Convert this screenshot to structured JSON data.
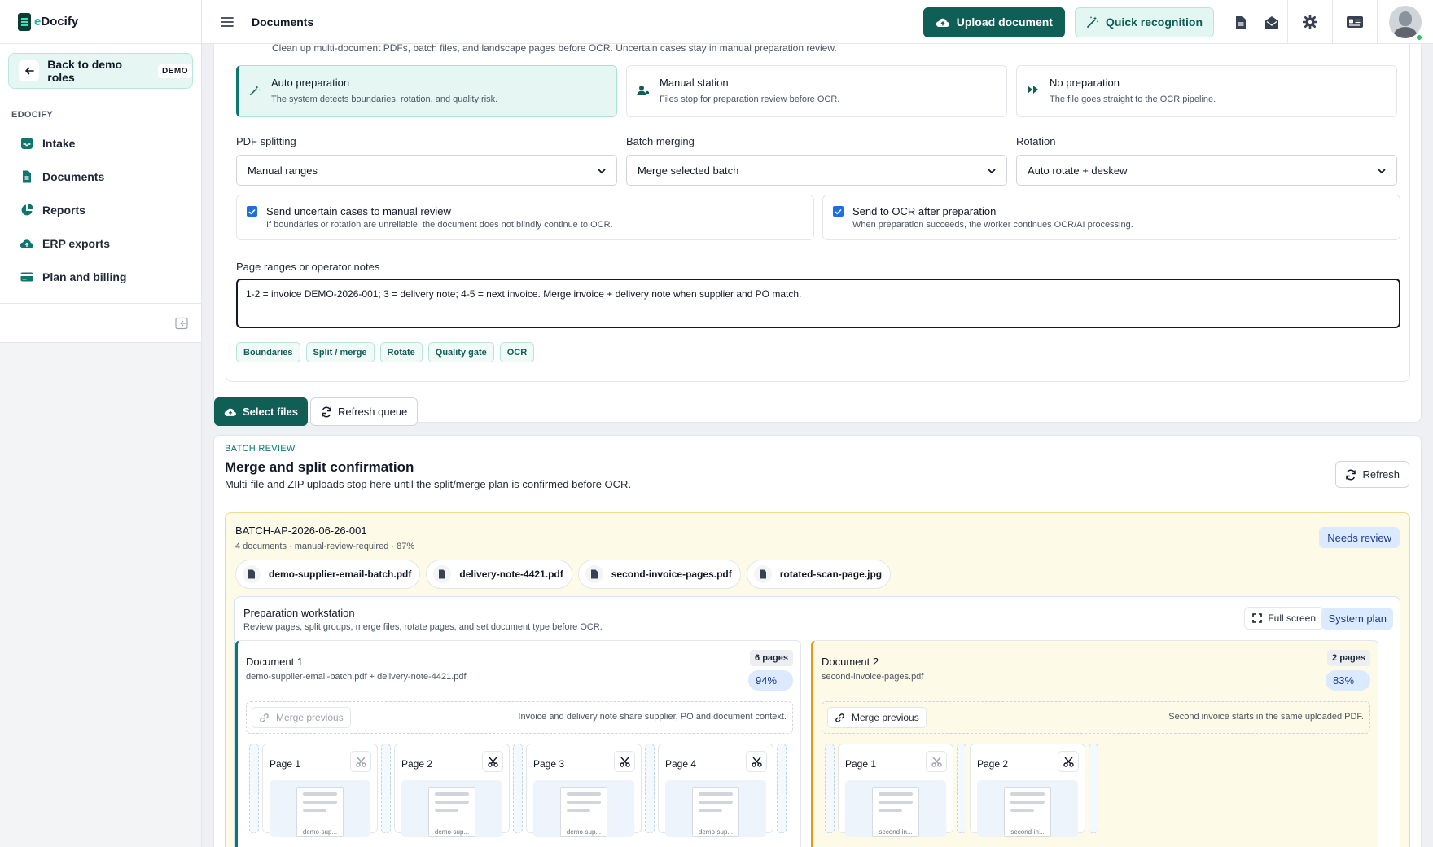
{
  "brand": {
    "prefix": "e",
    "name": "Docify"
  },
  "sidebar": {
    "back_label": "Back to demo roles",
    "demo_badge": "DEMO",
    "section": "EDOCIFY",
    "items": [
      {
        "label": "Intake",
        "icon": "inbox-icon"
      },
      {
        "label": "Documents",
        "icon": "file-icon"
      },
      {
        "label": "Reports",
        "icon": "pie-chart-icon"
      },
      {
        "label": "ERP exports",
        "icon": "cloud-upload-icon"
      },
      {
        "label": "Plan and billing",
        "icon": "credit-card-icon"
      }
    ]
  },
  "header": {
    "title": "Documents",
    "upload_label": "Upload document",
    "quick_label": "Quick recognition"
  },
  "prep": {
    "intro": "Clean up multi-document PDFs, batch files, and landscape pages before OCR. Uncertain cases stay in manual preparation review.",
    "modes": [
      {
        "title": "Auto preparation",
        "desc": "The system detects boundaries, rotation, and quality risk.",
        "active": true
      },
      {
        "title": "Manual station",
        "desc": "Files stop for preparation review before OCR.",
        "active": false
      },
      {
        "title": "No preparation",
        "desc": "The file goes straight to the OCR pipeline.",
        "active": false
      }
    ],
    "fields": [
      {
        "label": "PDF splitting",
        "value": "Manual ranges"
      },
      {
        "label": "Batch merging",
        "value": "Merge selected batch"
      },
      {
        "label": "Rotation",
        "value": "Auto rotate + deskew"
      }
    ],
    "checks": [
      {
        "title": "Send uncertain cases to manual review",
        "desc": "If boundaries or rotation are unreliable, the document does not blindly continue to OCR.",
        "checked": true
      },
      {
        "title": "Send to OCR after preparation",
        "desc": "When preparation succeeds, the worker continues OCR/AI processing.",
        "checked": true
      }
    ],
    "notes_label": "Page ranges or operator notes",
    "notes_value": "1-2 = invoice DEMO-2026-001; 3 = delivery note; 4-5 = next invoice. Merge invoice + delivery note when supplier and PO match.",
    "chips": [
      "Boundaries",
      "Split / merge",
      "Rotate",
      "Quality gate",
      "OCR"
    ],
    "select_files": "Select files",
    "refresh_queue": "Refresh queue"
  },
  "batch_review": {
    "eyebrow": "BATCH REVIEW",
    "title": "Merge and split confirmation",
    "desc": "Multi-file and ZIP uploads stop here until the split/merge plan is confirmed before OCR.",
    "refresh": "Refresh",
    "batch_id": "BATCH-AP-2026-06-26-001",
    "batch_meta": "4 documents · manual-review-required · 87%",
    "status": "Needs review",
    "files": [
      "demo-supplier-email-batch.pdf",
      "delivery-note-4421.pdf",
      "second-invoice-pages.pdf",
      "rotated-scan-page.jpg"
    ],
    "workstation": {
      "title": "Preparation workstation",
      "desc": "Review pages, split groups, merge files, rotate pages, and set document type before OCR.",
      "fullscreen": "Full screen",
      "plan": "System plan"
    },
    "documents": [
      {
        "title": "Document 1",
        "source": "demo-supplier-email-batch.pdf + delivery-note-4421.pdf",
        "pages_badge": "6 pages",
        "confidence": "94%",
        "merge_label": "Merge previous",
        "merge_note": "Invoice and delivery note share supplier, PO and document context.",
        "pages": [
          {
            "label": "Page 1",
            "thumb": "demo-sup..."
          },
          {
            "label": "Page 2",
            "thumb": "demo-sup..."
          },
          {
            "label": "Page 3",
            "thumb": "demo-sup..."
          },
          {
            "label": "Page 4",
            "thumb": "demo-sup..."
          }
        ]
      },
      {
        "title": "Document 2",
        "source": "second-invoice-pages.pdf",
        "pages_badge": "2 pages",
        "confidence": "83%",
        "merge_label": "Merge previous",
        "merge_note": "Second invoice starts in the same uploaded PDF.",
        "pages": [
          {
            "label": "Page 1",
            "thumb": "second-in..."
          },
          {
            "label": "Page 2",
            "thumb": "second-in..."
          }
        ]
      }
    ]
  },
  "colors": {
    "brand": "#0f5f57",
    "accent": "#14b8a6",
    "info": "#dbeafe",
    "warning_bg": "#fefae8"
  }
}
